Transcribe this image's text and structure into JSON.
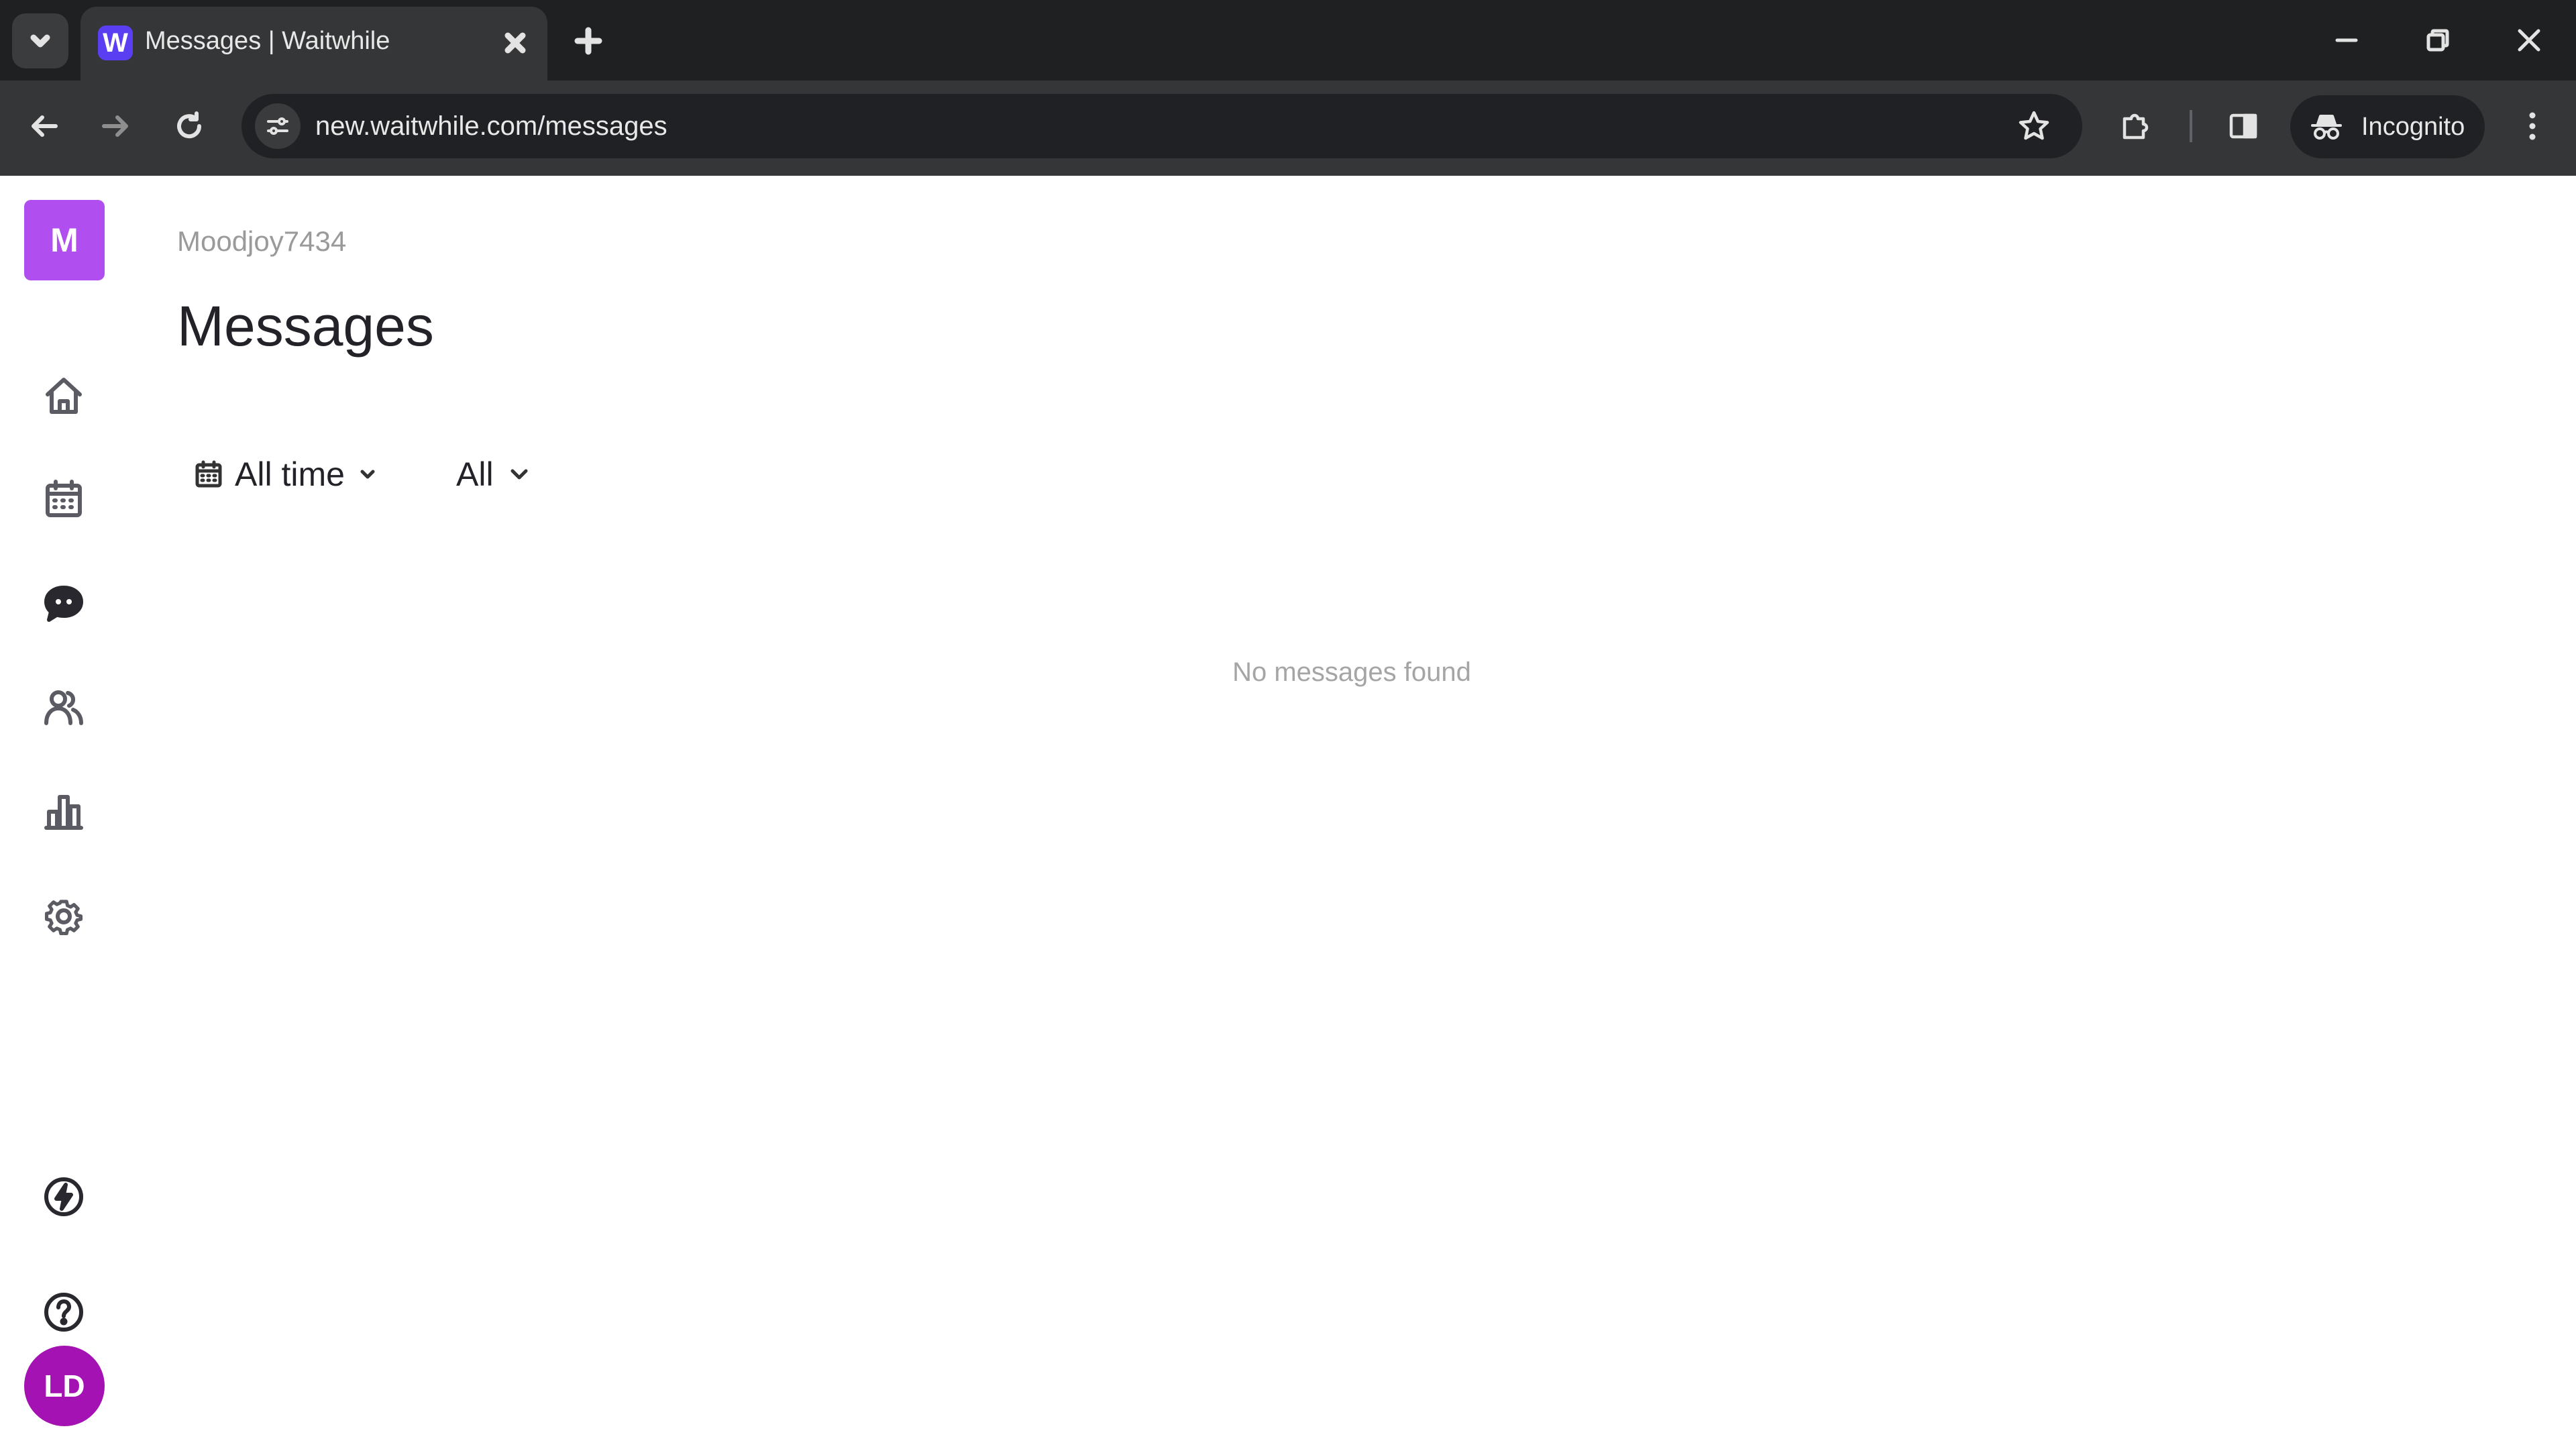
{
  "browser": {
    "tab": {
      "title": "Messages | Waitwhile",
      "favicon_letter": "W"
    },
    "address_bar": {
      "url": "new.waitwhile.com/messages"
    },
    "incognito_label": "Incognito",
    "icons": {
      "tab_list": "chevron-down-icon",
      "close_tab": "close-icon",
      "new_tab": "plus-icon",
      "back": "arrow-left-icon",
      "forward": "arrow-right-icon",
      "reload": "reload-icon",
      "site_info": "tune-icon",
      "bookmark": "star-icon",
      "extensions": "puzzle-icon",
      "side_panel": "side-panel-icon",
      "menu": "three-dots-icon"
    }
  },
  "sidebar": {
    "logo_letter": "M",
    "avatar_initials": "LD",
    "items": [
      {
        "id": "home",
        "icon": "home-icon"
      },
      {
        "id": "calendar",
        "icon": "calendar-icon"
      },
      {
        "id": "messages",
        "icon": "chat-bubble-icon",
        "active": true
      },
      {
        "id": "customers",
        "icon": "users-icon"
      },
      {
        "id": "analytics",
        "icon": "bar-chart-icon"
      },
      {
        "id": "settings",
        "icon": "gear-icon"
      },
      {
        "id": "whats-new",
        "icon": "lightning-icon"
      },
      {
        "id": "help",
        "icon": "help-icon"
      }
    ]
  },
  "main": {
    "account_name": "Moodjoy7434",
    "title": "Messages",
    "filters": {
      "date_range": "All time",
      "type": "All"
    },
    "empty_state": "No messages found"
  },
  "colors": {
    "logo_tile": "#b04ef0",
    "avatar": "#a412b3",
    "tab_favicon": "#5a3ff2",
    "chrome_dark": "#1f2021",
    "chrome_toolbar": "#353637"
  }
}
